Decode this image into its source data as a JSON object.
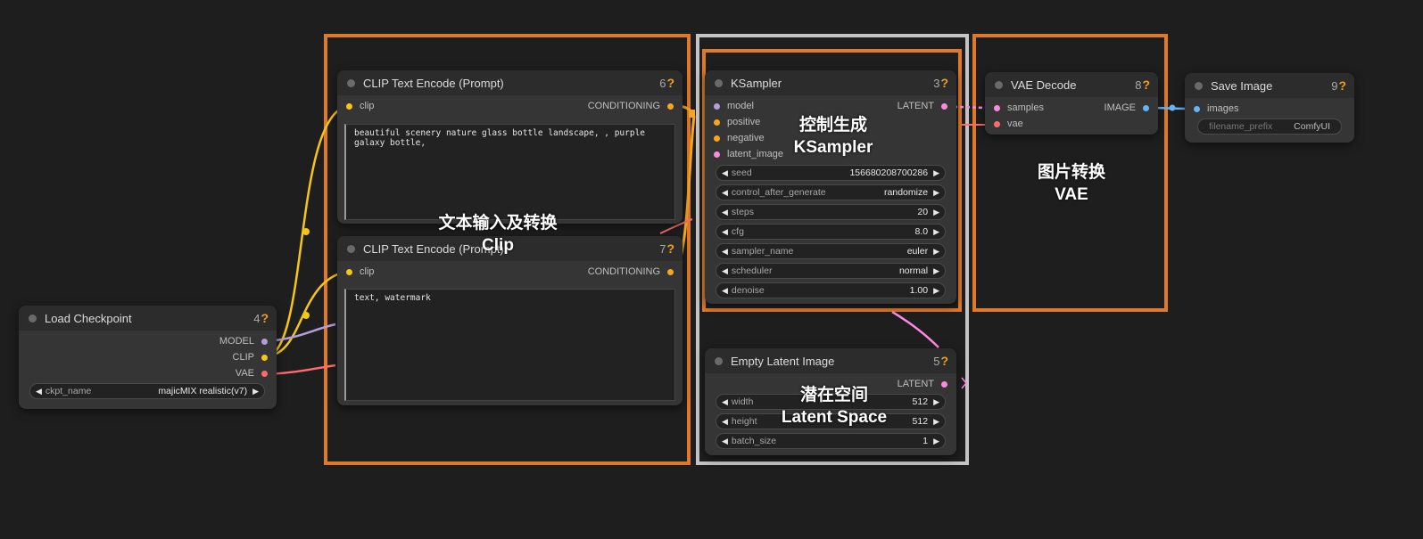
{
  "colors": {
    "background": "#1e1e1e",
    "group_orange": "#e07a28",
    "group_gray": "#c4c4c4",
    "clip": "#f5c518",
    "conditioning": "#f5a623",
    "model": "#b39ddb",
    "vae": "#ff6b6b",
    "latent": "#ff88e0",
    "image": "#64b5f6"
  },
  "annotations": {
    "text": [
      "文本输入及转换",
      "Clip"
    ],
    "sampler": [
      "控制生成",
      "KSampler"
    ],
    "vae": [
      "图片转换",
      "VAE"
    ],
    "latent": [
      "潜在空间",
      "Latent Space"
    ]
  },
  "nodes": {
    "load_checkpoint": {
      "title": "Load Checkpoint",
      "id": "4",
      "help": "?",
      "outputs": [
        "MODEL",
        "CLIP",
        "VAE"
      ],
      "ckpt": {
        "label": "ckpt_name",
        "value": "majicMIX realistic(v7)"
      }
    },
    "clip_pos": {
      "title": "CLIP Text Encode (Prompt)",
      "id": "6",
      "help": "?",
      "input": "clip",
      "output": "CONDITIONING",
      "text": "beautiful scenery nature glass bottle landscape, , purple galaxy bottle,"
    },
    "clip_neg": {
      "title": "CLIP Text Encode (Prompt)",
      "id": "7",
      "help": "?",
      "input": "clip",
      "output": "CONDITIONING",
      "text": "text, watermark"
    },
    "ksampler": {
      "title": "KSampler",
      "id": "3",
      "help": "?",
      "inputs": [
        "model",
        "positive",
        "negative",
        "latent_image"
      ],
      "output": "LATENT",
      "widgets": [
        {
          "label": "seed",
          "value": "156680208700286"
        },
        {
          "label": "control_after_generate",
          "value": "randomize"
        },
        {
          "label": "steps",
          "value": "20"
        },
        {
          "label": "cfg",
          "value": "8.0"
        },
        {
          "label": "sampler_name",
          "value": "euler"
        },
        {
          "label": "scheduler",
          "value": "normal"
        },
        {
          "label": "denoise",
          "value": "1.00"
        }
      ]
    },
    "empty_latent": {
      "title": "Empty Latent Image",
      "id": "5",
      "help": "?",
      "output": "LATENT",
      "widgets": [
        {
          "label": "width",
          "value": "512"
        },
        {
          "label": "height",
          "value": "512"
        },
        {
          "label": "batch_size",
          "value": "1"
        }
      ]
    },
    "vae_decode": {
      "title": "VAE Decode",
      "id": "8",
      "help": "?",
      "inputs": [
        "samples",
        "vae"
      ],
      "output": "IMAGE"
    },
    "save_image": {
      "title": "Save Image",
      "id": "9",
      "help": "?",
      "input": "images",
      "prefix": {
        "label": "filename_prefix",
        "value": "ComfyUI"
      }
    }
  }
}
